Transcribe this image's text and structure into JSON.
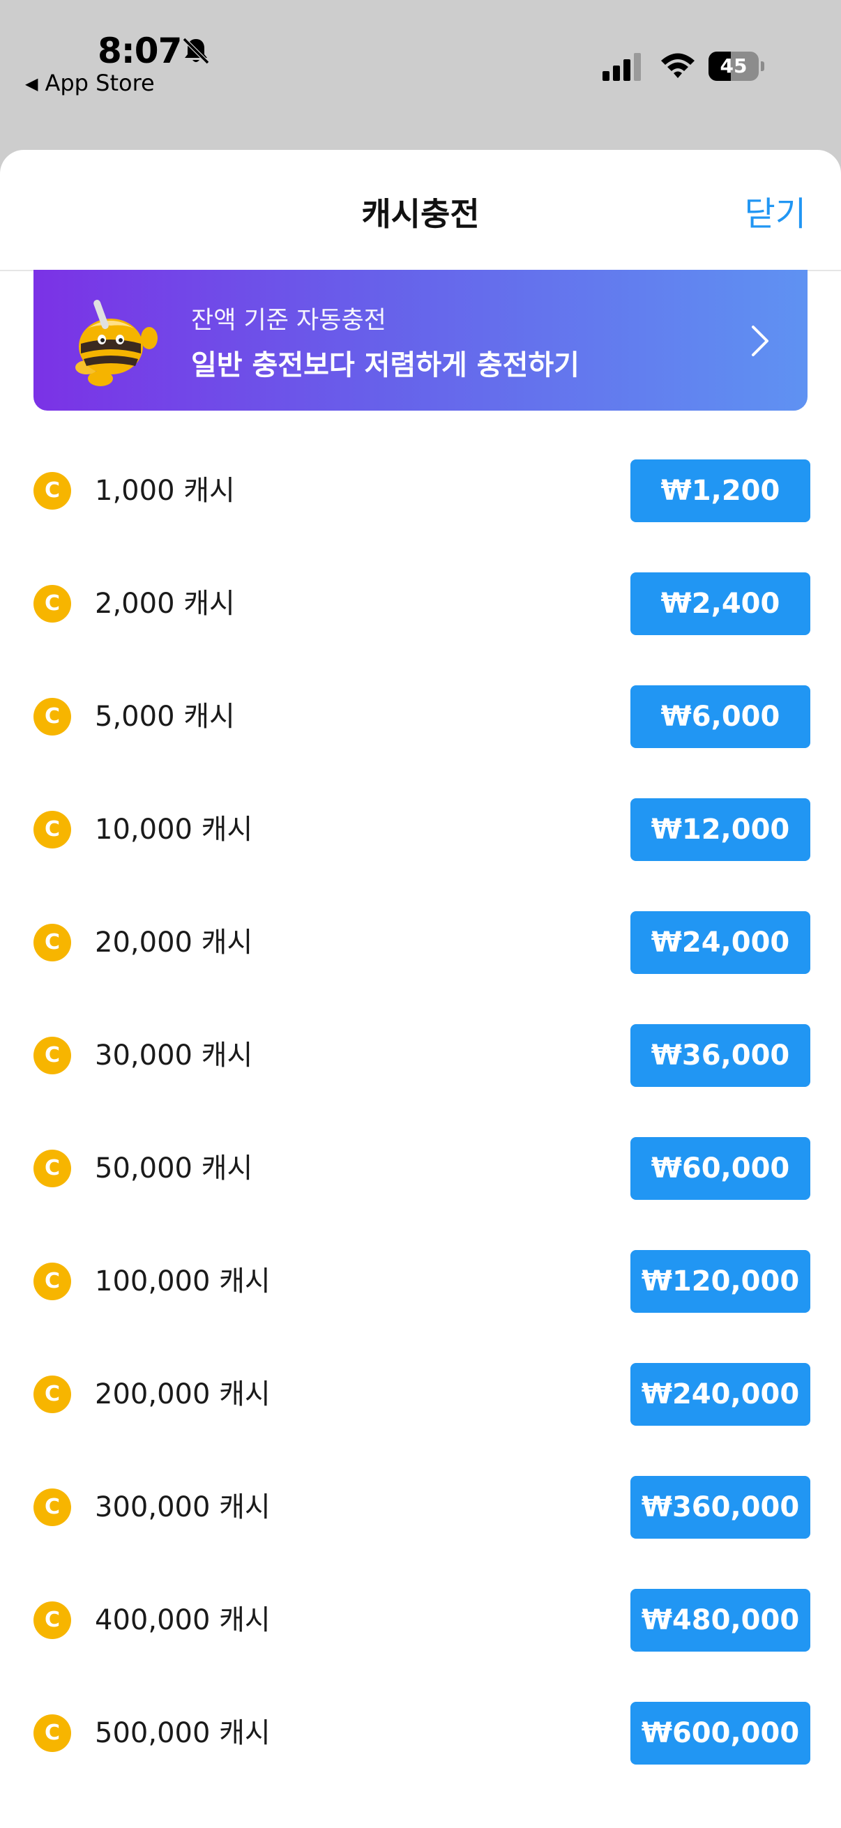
{
  "status_bar": {
    "time": "8:07",
    "back_label": "App Store",
    "battery_level": "45",
    "battery_fraction": 0.45
  },
  "sheet": {
    "title": "캐시충전",
    "close_label": "닫기"
  },
  "banner": {
    "subtitle": "잔액 기준 자동충전",
    "title": "일반 충전보다 저렴하게 충전하기"
  },
  "coin_icon": "C",
  "items": [
    {
      "label": "1,000 캐시",
      "price": "₩1,200"
    },
    {
      "label": "2,000 캐시",
      "price": "₩2,400"
    },
    {
      "label": "5,000 캐시",
      "price": "₩6,000"
    },
    {
      "label": "10,000 캐시",
      "price": "₩12,000"
    },
    {
      "label": "20,000 캐시",
      "price": "₩24,000"
    },
    {
      "label": "30,000 캐시",
      "price": "₩36,000"
    },
    {
      "label": "50,000 캐시",
      "price": "₩60,000"
    },
    {
      "label": "100,000 캐시",
      "price": "₩120,000"
    },
    {
      "label": "200,000 캐시",
      "price": "₩240,000"
    },
    {
      "label": "300,000 캐시",
      "price": "₩360,000"
    },
    {
      "label": "400,000 캐시",
      "price": "₩480,000"
    },
    {
      "label": "500,000 캐시",
      "price": "₩600,000"
    }
  ],
  "colors": {
    "accent": "#2196f3",
    "coin": "#f7b500",
    "banner_start": "#7b32e6",
    "banner_end": "#5f92f2"
  }
}
